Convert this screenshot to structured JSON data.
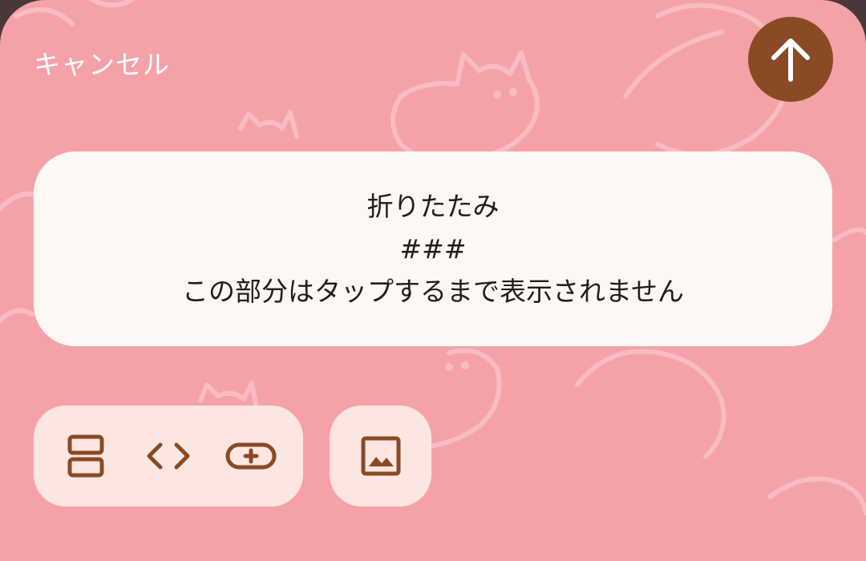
{
  "header": {
    "cancel_label": "キャンセル",
    "send_icon": "arrow-up-icon"
  },
  "note": {
    "lines": [
      "折りたたみ",
      "###",
      "この部分はタップするまで表示されません"
    ]
  },
  "toolbar": {
    "buttons": [
      {
        "icon": "layout-split-icon"
      },
      {
        "icon": "code-icon"
      },
      {
        "icon": "add-button-icon"
      }
    ],
    "image_button": {
      "icon": "image-icon"
    }
  },
  "colors": {
    "background": "#f4a2a8",
    "accent": "#8a4a26",
    "card": "#fdf8f4",
    "toolbar": "#fde6e2",
    "pattern": "#f8bcc1"
  }
}
